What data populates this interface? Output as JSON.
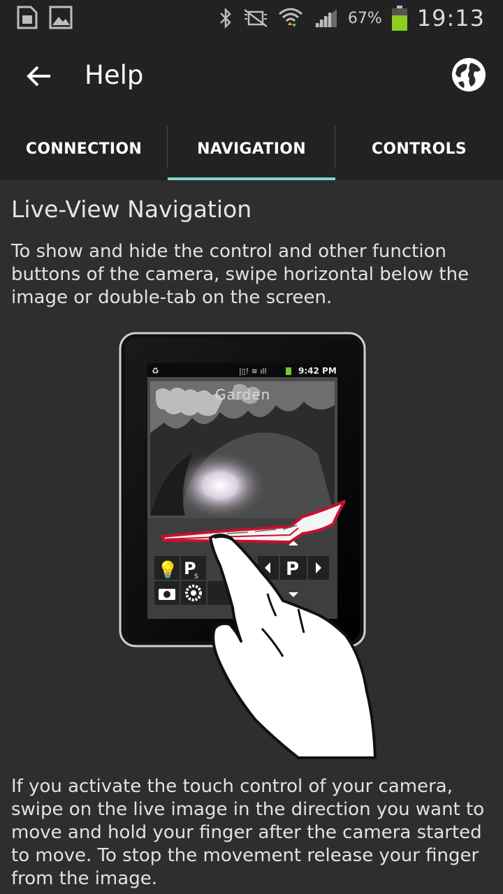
{
  "status_bar": {
    "left_icons": [
      "sim-card-icon",
      "gallery-icon"
    ],
    "right_icons": [
      "bluetooth-icon",
      "mute-icon",
      "wifi-icon",
      "signal-icon",
      "battery-icon"
    ],
    "battery_percent": "67%",
    "time": "19:13",
    "battery_color": "#8ccf1e"
  },
  "app_bar": {
    "title": "Help",
    "back_icon": "arrow-back-icon",
    "action_icon": "globe-icon"
  },
  "tabs": [
    {
      "label": "CONNECTION",
      "selected": false
    },
    {
      "label": "NAVIGATION",
      "selected": true
    },
    {
      "label": "CONTROLS",
      "selected": false
    }
  ],
  "accent_color": "#7fd6cc",
  "content": {
    "title": "Live-View Navigation",
    "paragraph1": "To show and hide the control and other function buttons of the camera, swipe horizontal below the image or double-tab on the screen.",
    "paragraph2": "If you activate the touch control of your camera, swipe on the live image in the direction you want to move and hold your finger after the camera started to move. To stop the movement release your finger from the image."
  },
  "illustration": {
    "tablet_status_time": "9:42 PM",
    "camera_name": "Garden",
    "ptz_label": "P",
    "preset_label": "P",
    "preset_sub": "S"
  }
}
